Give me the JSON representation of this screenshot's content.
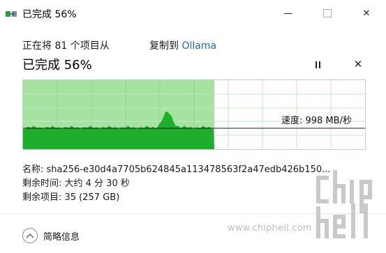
{
  "window": {
    "title": "已完成 56%"
  },
  "copy": {
    "status_prefix": "正在将 81 个项目从",
    "copy_to_label": "复制到",
    "destination": "Ollama"
  },
  "progress": {
    "heading": "已完成 56%",
    "percent": 56,
    "speed": "速度: 998 MB/秒"
  },
  "details": {
    "name": "名称: sha256-e30d4a7705b624845a113478563f2a47edb426b150...",
    "time_remaining": "剩余时间: 大约 4 分 30 秒",
    "items_remaining": "剩余项目: 35 (257 GB)"
  },
  "footer": {
    "toggle_label": "简略信息"
  },
  "watermark": {
    "url": "www.chiphell.com",
    "logo_text": "chip hell"
  },
  "colors": {
    "graph_fill_light": "#a6e3a0",
    "graph_fill_dark": "#1fae2c",
    "graph_grid": "#c4e7c4",
    "link": "#1a6ab8"
  }
}
